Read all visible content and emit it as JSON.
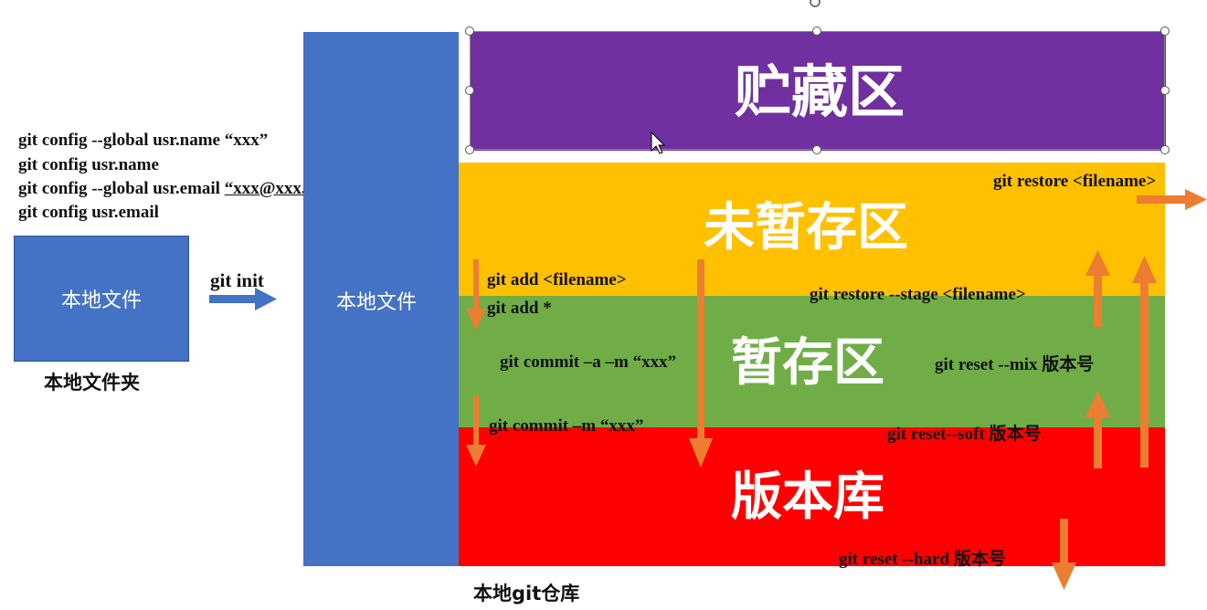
{
  "config_lines": [
    "git config --global usr.name “xxx”",
    "git config usr.name",
    "git config --global usr.email “xxx@xxx.xxx”",
    "git config usr.email"
  ],
  "config_line3_prefix": "git config --global usr.email ",
  "config_line3_email": "“xxx@xxx.xxx”",
  "local_folder": {
    "box_label": "本地文件",
    "caption": "本地文件夹"
  },
  "git_init": "git init",
  "repo": {
    "working_label": "本地文件",
    "caption": "本地git仓库"
  },
  "zones": {
    "stash": "贮藏区",
    "unstaged": "未暂存区",
    "staged": "暂存区",
    "repository": "版本库"
  },
  "commands": {
    "git_add_file": "git add <filename>",
    "git_add_all": "git add *",
    "git_commit_a": "git commit –a –m “xxx”",
    "git_commit_m": "git commit –m “xxx”",
    "git_restore": "git restore <filename>",
    "git_restore_stage": "git restore --stage <filename>",
    "git_reset_mix": "git reset --mix 版本号",
    "git_reset_soft": "git reset--soft 版本号",
    "git_reset_hard": "git reset --hard 版本号"
  },
  "colors": {
    "blue": "#4472C4",
    "purple": "#7030A0",
    "yellow": "#FFC000",
    "green": "#70AD47",
    "red": "#FF0000",
    "arrow_orange": "#ED7D31"
  }
}
